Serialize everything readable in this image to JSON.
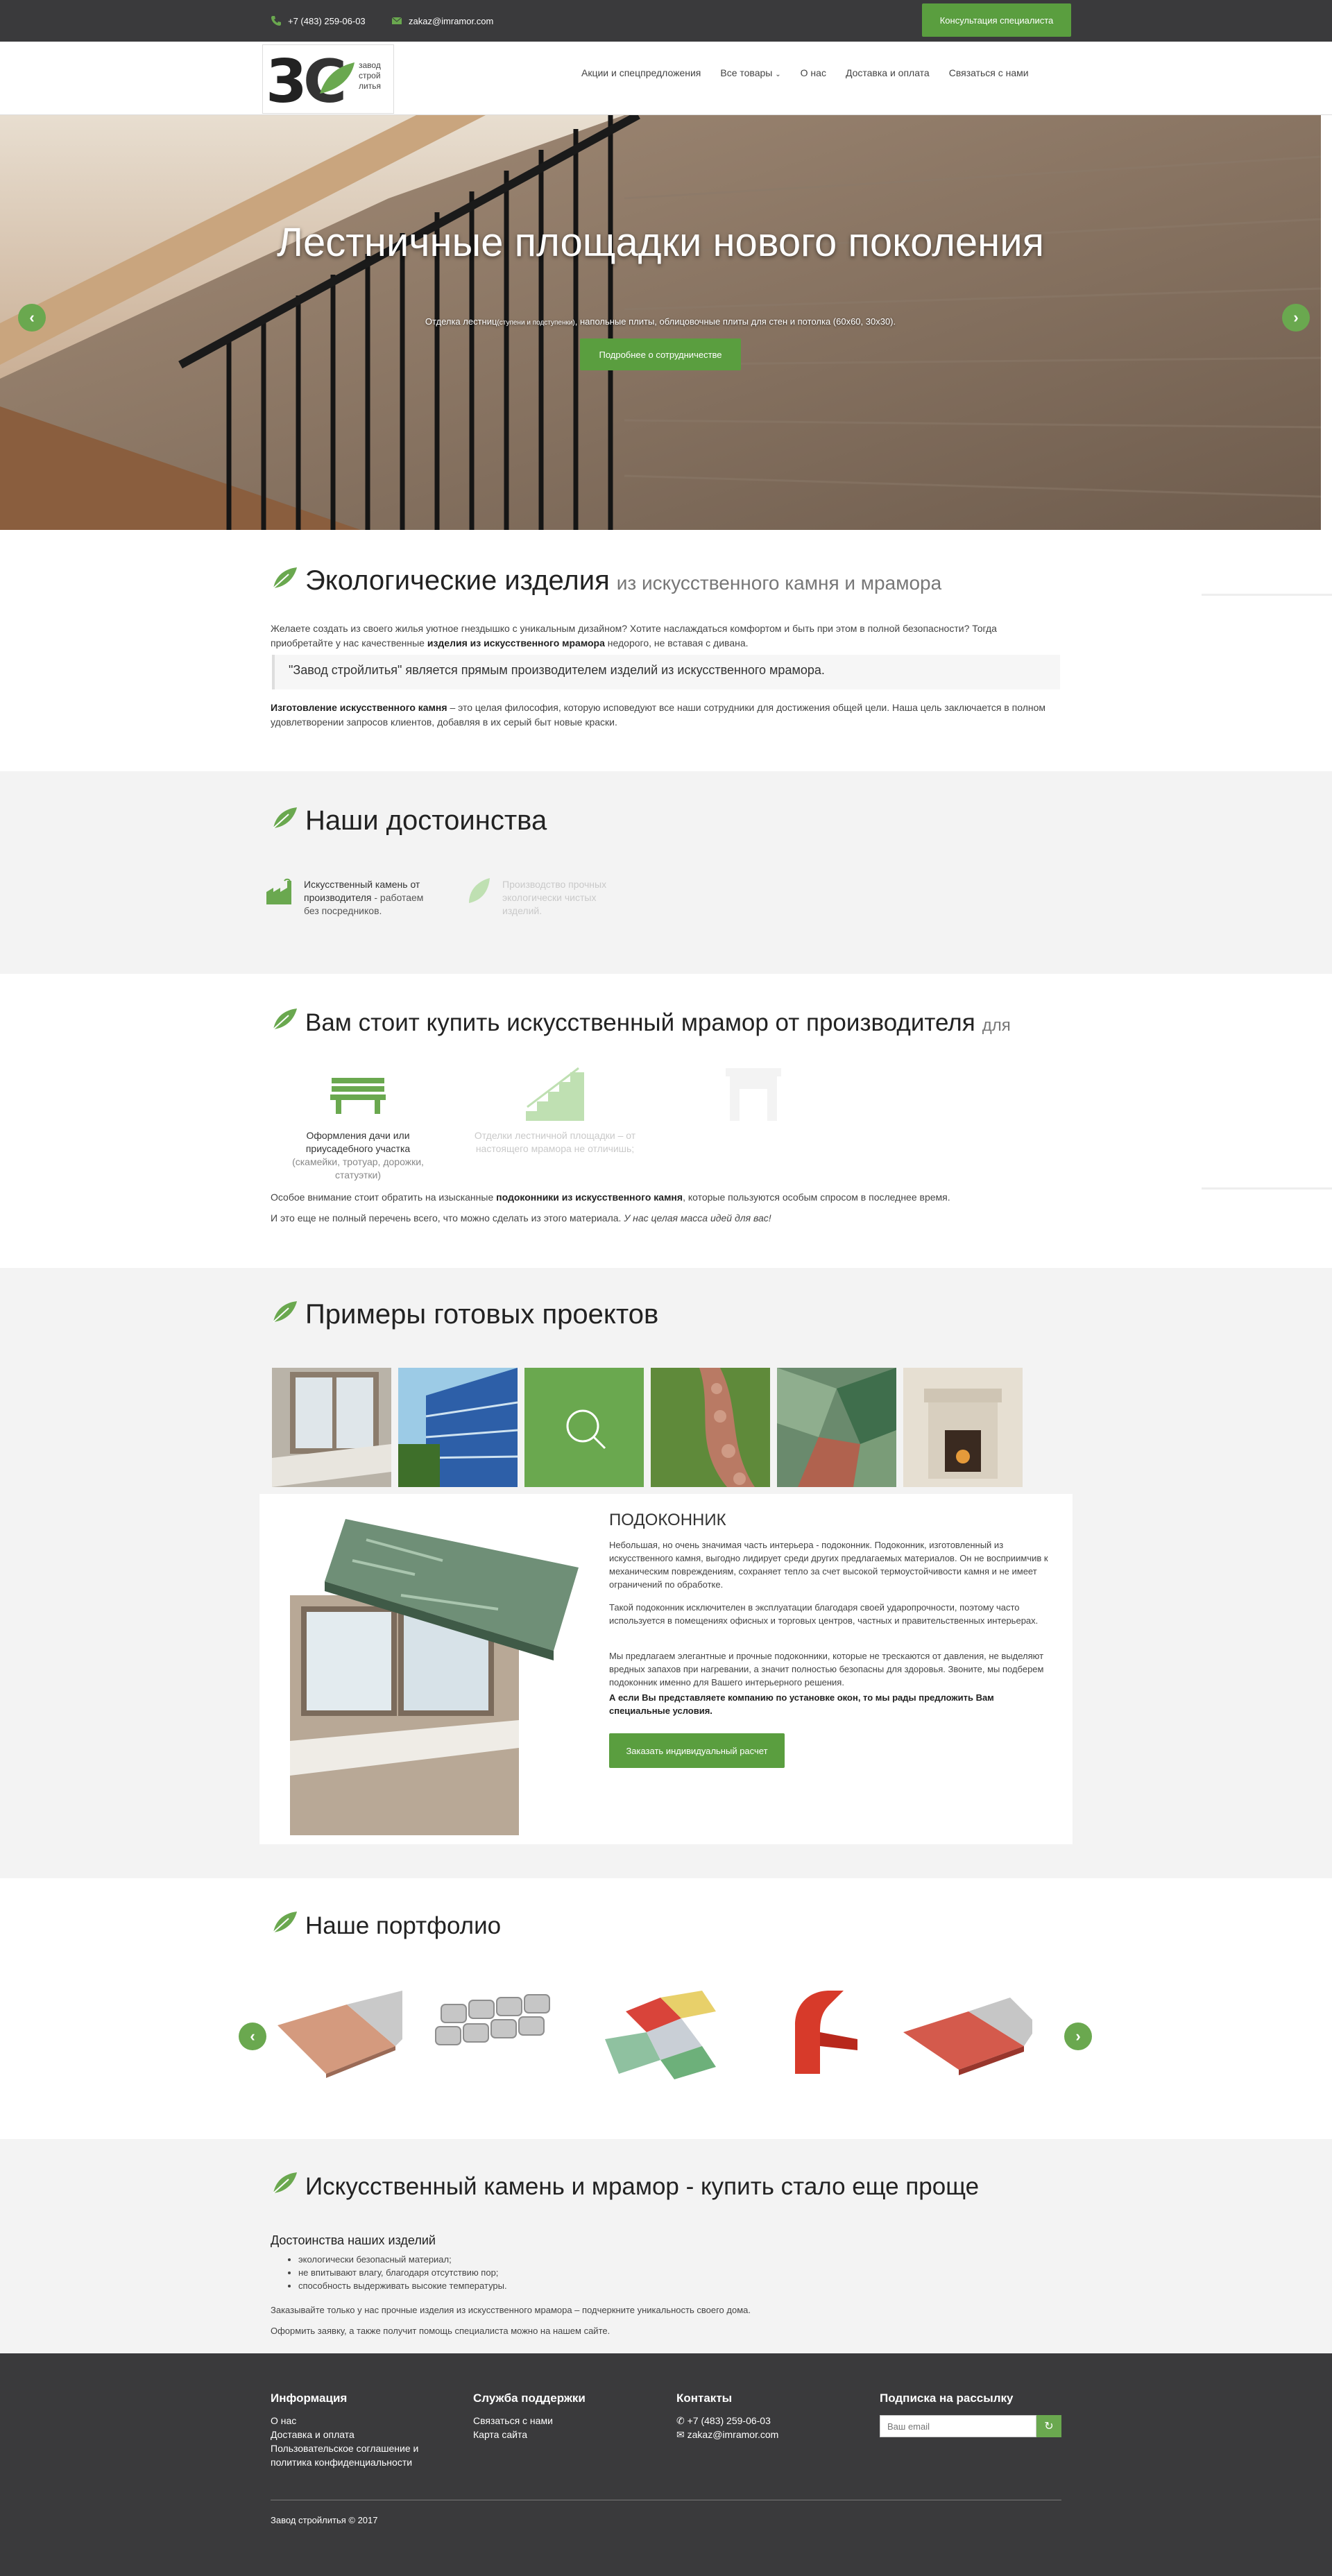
{
  "topbar": {
    "phone": "+7 (483) 259-06-03",
    "email": "zakaz@imramor.com",
    "consult_button": "Консультация специалиста"
  },
  "logo": {
    "line1": "завод",
    "line2": "строй",
    "line3": "литья"
  },
  "nav": {
    "items": [
      "Акции и спецпредложения",
      "Все товары",
      "О нас",
      "Доставка и оплата",
      "Связаться с нами"
    ]
  },
  "hero": {
    "title": "Лестничные площадки нового поколения",
    "subtitle_a": "Отделка лестниц",
    "subtitle_small": "(ступени и подступенки)",
    "subtitle_b": ", напольные плиты, облицовочные плиты для стен и потолка (60х60, 30х30).",
    "button": "Подробнее о сотрудничестве"
  },
  "eco": {
    "title": "Экологические изделия",
    "title_small": "из искусственного камня и мрамора",
    "p1a": "Желаете создать из своего жилья уютное гнездышко с уникальным дизайном? Хотите наслаждаться комфортом и быть при этом в полной безопасности? Тогда приобретайте у нас качественные ",
    "p1b": "изделия из искусственного мрамора",
    "p1c": " недорого, не вставая с дивана.",
    "quote": "\"Завод стройлитья\" является прямым производителем изделий из искусственного мрамора.",
    "p2a": "Изготовление искусственного камня",
    "p2b": " – это целая философия, которую исповедуют все наши сотрудники для достижения общей цели. Наша цель заключается в полном удовлетворении запросов клиентов, добавляя в их серый быт новые краски."
  },
  "advantages": {
    "title": "Наши достоинства",
    "items": [
      {
        "strong": "Искусственный камень от производителя",
        "rest": " - работаем без посредников."
      },
      {
        "strong": "",
        "rest": "Производство прочных экологически чистых изделий."
      }
    ]
  },
  "buy": {
    "title": "Вам стоит купить искусственный мрамор от производителя",
    "title_small": "для",
    "uses": [
      {
        "strong": "Оформления дачи или приусадебного участка",
        "rest": " (скамейки, тротуар, дорожки, статуэтки)"
      },
      {
        "strong": "Отделки лестничной площадки",
        "rest": " – от настоящего мрамора не отличишь;"
      },
      {
        "strong": "",
        "rest": ""
      }
    ],
    "p1a": "Особое внимание стоит обратить на изысканные ",
    "p1b": "подоконники из искусственного камня",
    "p1c": ", которые пользуются особым спросом в последнее время.",
    "p2a": "И это еще не полный перечень всего, что можно сделать из этого материала. ",
    "p2b": "У нас целая масса идей для вас!"
  },
  "projects": {
    "title": "Примеры готовых проектов",
    "detail_title": "ПОДОКОННИК",
    "d1": "Небольшая, но очень значимая часть интерьера - подоконник. Подоконник, изготовленный из искусственного камня, выгодно лидирует среди других предлагаемых материалов. Он не восприимчив к механическим повреждениям, сохраняет тепло за счет высокой термоустойчивости камня и не имеет ограничений по обработке.",
    "d2": "Такой подоконник исключителен в эксплуатации благодаря своей ударопрочности, поэтому часто используется в помещениях офисных и торговых центров, частных и правительственных интерьерах.",
    "d3": "Мы предлагаем элегантные и прочные подоконники, которые не трескаются от давления, не выделяют вредных запахов при нагревании, а значит полностью безопасны для здоровья. Звоните, мы подберем подоконник именно для Вашего интерьерного решения.",
    "d4": "А если Вы представляете компанию по установке окон, то мы рады предложить Вам специальные условия.",
    "button": "Заказать индивидуальный расчет"
  },
  "portfolio": {
    "title": "Наше портфолио"
  },
  "easy": {
    "title": "Искусственный камень и мрамор - купить стало еще проще",
    "subtitle": "Достоинства наших изделий",
    "list": [
      "экологически безопасный материал;",
      "не впитывают влагу, благодаря отсутствию пор;",
      "способность выдерживать высокие температуры."
    ],
    "p1": "Заказывайте только у нас прочные изделия из искусственного мрамора – подчеркните уникальность своего дома.",
    "p2": "Оформить заявку, а также получит помощь специалиста можно на нашем сайте."
  },
  "footer": {
    "info_title": "Информация",
    "info_links": [
      "О нас",
      "Доставка и оплата",
      "Пользовательское соглашение и политика конфиденциальности"
    ],
    "support_title": "Служба поддержки",
    "support_links": [
      "Связаться с нами",
      "Карта сайта"
    ],
    "contacts_title": "Контакты",
    "phone": "+7 (483) 259-06-03",
    "email": "zakaz@imramor.com",
    "subscribe_title": "Подписка на рассылку",
    "email_placeholder": "Ваш email",
    "copyright": "Завод стройлитья © 2017"
  },
  "colors": {
    "accent": "#5a9e3f",
    "dark": "#3a3a3c",
    "light_bg": "#f3f3f3"
  }
}
